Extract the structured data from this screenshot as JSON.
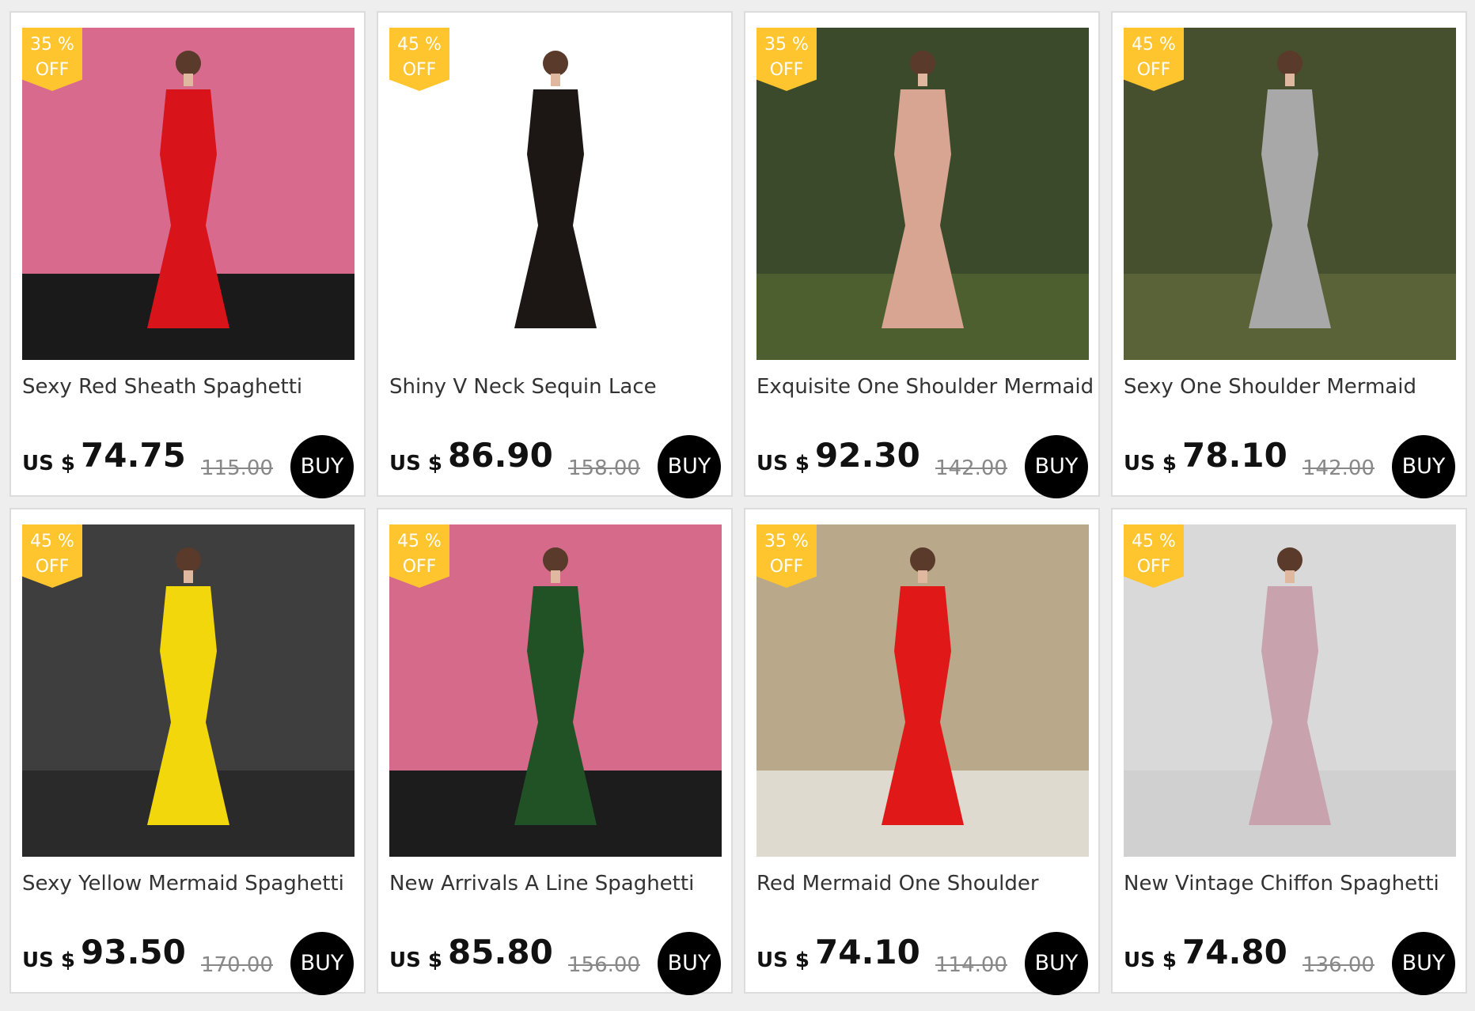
{
  "currency_label": "US $",
  "buy_label": "BUY",
  "products": [
    {
      "title": "Sexy Red Sheath Spaghetti",
      "price": "74.75",
      "old_price": "115.00",
      "discount_num": "35 %",
      "discount_word": "OFF",
      "bg": "#d86a8e",
      "floor": "#1a1a1a",
      "dress": "#d8141a"
    },
    {
      "title": "Shiny V Neck Sequin Lace",
      "price": "86.90",
      "old_price": "158.00",
      "discount_num": "45 %",
      "discount_word": "OFF",
      "bg": "#ffffff",
      "floor": "#ffffff",
      "dress": "#1c1714"
    },
    {
      "title": "Exquisite One Shoulder Mermaid",
      "price": "92.30",
      "old_price": "142.00",
      "discount_num": "35 %",
      "discount_word": "OFF",
      "bg": "#3a4a2a",
      "floor": "#4d5f2f",
      "dress": "#d8a592"
    },
    {
      "title": "Sexy One Shoulder Mermaid",
      "price": "78.10",
      "old_price": "142.00",
      "discount_num": "45 %",
      "discount_word": "OFF",
      "bg": "#46502e",
      "floor": "#5a6238",
      "dress": "#a8a8a8"
    },
    {
      "title": "Sexy Yellow Mermaid Spaghetti",
      "price": "93.50",
      "old_price": "170.00",
      "discount_num": "45 %",
      "discount_word": "OFF",
      "bg": "#3e3e3e",
      "floor": "#2a2a2a",
      "dress": "#f2d70c"
    },
    {
      "title": "New Arrivals A Line Spaghetti",
      "price": "85.80",
      "old_price": "156.00",
      "discount_num": "45 %",
      "discount_word": "OFF",
      "bg": "#d66a8a",
      "floor": "#1c1c1c",
      "dress": "#215226"
    },
    {
      "title": "Red Mermaid One Shoulder",
      "price": "74.10",
      "old_price": "114.00",
      "discount_num": "35 %",
      "discount_word": "OFF",
      "bg": "#b9a98a",
      "floor": "#dedad0",
      "dress": "#e01818"
    },
    {
      "title": "New Vintage Chiffon Spaghetti",
      "price": "74.80",
      "old_price": "136.00",
      "discount_num": "45 %",
      "discount_word": "OFF",
      "bg": "#d9d9d9",
      "floor": "#d0d0d0",
      "dress": "#c8a3ae"
    }
  ]
}
